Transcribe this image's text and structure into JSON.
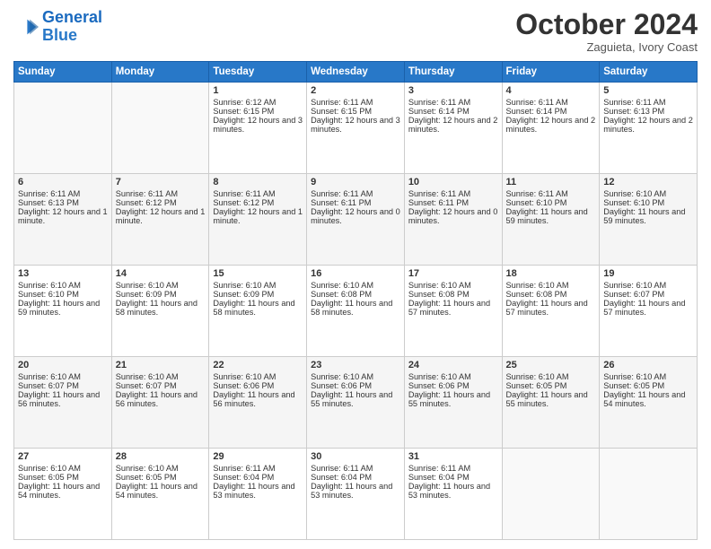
{
  "header": {
    "logo_line1": "General",
    "logo_line2": "Blue",
    "month": "October 2024",
    "location": "Zaguieta, Ivory Coast"
  },
  "days_of_week": [
    "Sunday",
    "Monday",
    "Tuesday",
    "Wednesday",
    "Thursday",
    "Friday",
    "Saturday"
  ],
  "weeks": [
    [
      {
        "day": "",
        "sunrise": "",
        "sunset": "",
        "daylight": "",
        "empty": true
      },
      {
        "day": "",
        "sunrise": "",
        "sunset": "",
        "daylight": "",
        "empty": true
      },
      {
        "day": "1",
        "sunrise": "Sunrise: 6:12 AM",
        "sunset": "Sunset: 6:15 PM",
        "daylight": "Daylight: 12 hours and 3 minutes."
      },
      {
        "day": "2",
        "sunrise": "Sunrise: 6:11 AM",
        "sunset": "Sunset: 6:15 PM",
        "daylight": "Daylight: 12 hours and 3 minutes."
      },
      {
        "day": "3",
        "sunrise": "Sunrise: 6:11 AM",
        "sunset": "Sunset: 6:14 PM",
        "daylight": "Daylight: 12 hours and 2 minutes."
      },
      {
        "day": "4",
        "sunrise": "Sunrise: 6:11 AM",
        "sunset": "Sunset: 6:14 PM",
        "daylight": "Daylight: 12 hours and 2 minutes."
      },
      {
        "day": "5",
        "sunrise": "Sunrise: 6:11 AM",
        "sunset": "Sunset: 6:13 PM",
        "daylight": "Daylight: 12 hours and 2 minutes."
      }
    ],
    [
      {
        "day": "6",
        "sunrise": "Sunrise: 6:11 AM",
        "sunset": "Sunset: 6:13 PM",
        "daylight": "Daylight: 12 hours and 1 minute."
      },
      {
        "day": "7",
        "sunrise": "Sunrise: 6:11 AM",
        "sunset": "Sunset: 6:12 PM",
        "daylight": "Daylight: 12 hours and 1 minute."
      },
      {
        "day": "8",
        "sunrise": "Sunrise: 6:11 AM",
        "sunset": "Sunset: 6:12 PM",
        "daylight": "Daylight: 12 hours and 1 minute."
      },
      {
        "day": "9",
        "sunrise": "Sunrise: 6:11 AM",
        "sunset": "Sunset: 6:11 PM",
        "daylight": "Daylight: 12 hours and 0 minutes."
      },
      {
        "day": "10",
        "sunrise": "Sunrise: 6:11 AM",
        "sunset": "Sunset: 6:11 PM",
        "daylight": "Daylight: 12 hours and 0 minutes."
      },
      {
        "day": "11",
        "sunrise": "Sunrise: 6:11 AM",
        "sunset": "Sunset: 6:10 PM",
        "daylight": "Daylight: 11 hours and 59 minutes."
      },
      {
        "day": "12",
        "sunrise": "Sunrise: 6:10 AM",
        "sunset": "Sunset: 6:10 PM",
        "daylight": "Daylight: 11 hours and 59 minutes."
      }
    ],
    [
      {
        "day": "13",
        "sunrise": "Sunrise: 6:10 AM",
        "sunset": "Sunset: 6:10 PM",
        "daylight": "Daylight: 11 hours and 59 minutes."
      },
      {
        "day": "14",
        "sunrise": "Sunrise: 6:10 AM",
        "sunset": "Sunset: 6:09 PM",
        "daylight": "Daylight: 11 hours and 58 minutes."
      },
      {
        "day": "15",
        "sunrise": "Sunrise: 6:10 AM",
        "sunset": "Sunset: 6:09 PM",
        "daylight": "Daylight: 11 hours and 58 minutes."
      },
      {
        "day": "16",
        "sunrise": "Sunrise: 6:10 AM",
        "sunset": "Sunset: 6:08 PM",
        "daylight": "Daylight: 11 hours and 58 minutes."
      },
      {
        "day": "17",
        "sunrise": "Sunrise: 6:10 AM",
        "sunset": "Sunset: 6:08 PM",
        "daylight": "Daylight: 11 hours and 57 minutes."
      },
      {
        "day": "18",
        "sunrise": "Sunrise: 6:10 AM",
        "sunset": "Sunset: 6:08 PM",
        "daylight": "Daylight: 11 hours and 57 minutes."
      },
      {
        "day": "19",
        "sunrise": "Sunrise: 6:10 AM",
        "sunset": "Sunset: 6:07 PM",
        "daylight": "Daylight: 11 hours and 57 minutes."
      }
    ],
    [
      {
        "day": "20",
        "sunrise": "Sunrise: 6:10 AM",
        "sunset": "Sunset: 6:07 PM",
        "daylight": "Daylight: 11 hours and 56 minutes."
      },
      {
        "day": "21",
        "sunrise": "Sunrise: 6:10 AM",
        "sunset": "Sunset: 6:07 PM",
        "daylight": "Daylight: 11 hours and 56 minutes."
      },
      {
        "day": "22",
        "sunrise": "Sunrise: 6:10 AM",
        "sunset": "Sunset: 6:06 PM",
        "daylight": "Daylight: 11 hours and 56 minutes."
      },
      {
        "day": "23",
        "sunrise": "Sunrise: 6:10 AM",
        "sunset": "Sunset: 6:06 PM",
        "daylight": "Daylight: 11 hours and 55 minutes."
      },
      {
        "day": "24",
        "sunrise": "Sunrise: 6:10 AM",
        "sunset": "Sunset: 6:06 PM",
        "daylight": "Daylight: 11 hours and 55 minutes."
      },
      {
        "day": "25",
        "sunrise": "Sunrise: 6:10 AM",
        "sunset": "Sunset: 6:05 PM",
        "daylight": "Daylight: 11 hours and 55 minutes."
      },
      {
        "day": "26",
        "sunrise": "Sunrise: 6:10 AM",
        "sunset": "Sunset: 6:05 PM",
        "daylight": "Daylight: 11 hours and 54 minutes."
      }
    ],
    [
      {
        "day": "27",
        "sunrise": "Sunrise: 6:10 AM",
        "sunset": "Sunset: 6:05 PM",
        "daylight": "Daylight: 11 hours and 54 minutes."
      },
      {
        "day": "28",
        "sunrise": "Sunrise: 6:10 AM",
        "sunset": "Sunset: 6:05 PM",
        "daylight": "Daylight: 11 hours and 54 minutes."
      },
      {
        "day": "29",
        "sunrise": "Sunrise: 6:11 AM",
        "sunset": "Sunset: 6:04 PM",
        "daylight": "Daylight: 11 hours and 53 minutes."
      },
      {
        "day": "30",
        "sunrise": "Sunrise: 6:11 AM",
        "sunset": "Sunset: 6:04 PM",
        "daylight": "Daylight: 11 hours and 53 minutes."
      },
      {
        "day": "31",
        "sunrise": "Sunrise: 6:11 AM",
        "sunset": "Sunset: 6:04 PM",
        "daylight": "Daylight: 11 hours and 53 minutes."
      },
      {
        "day": "",
        "sunrise": "",
        "sunset": "",
        "daylight": "",
        "empty": true
      },
      {
        "day": "",
        "sunrise": "",
        "sunset": "",
        "daylight": "",
        "empty": true
      }
    ]
  ]
}
